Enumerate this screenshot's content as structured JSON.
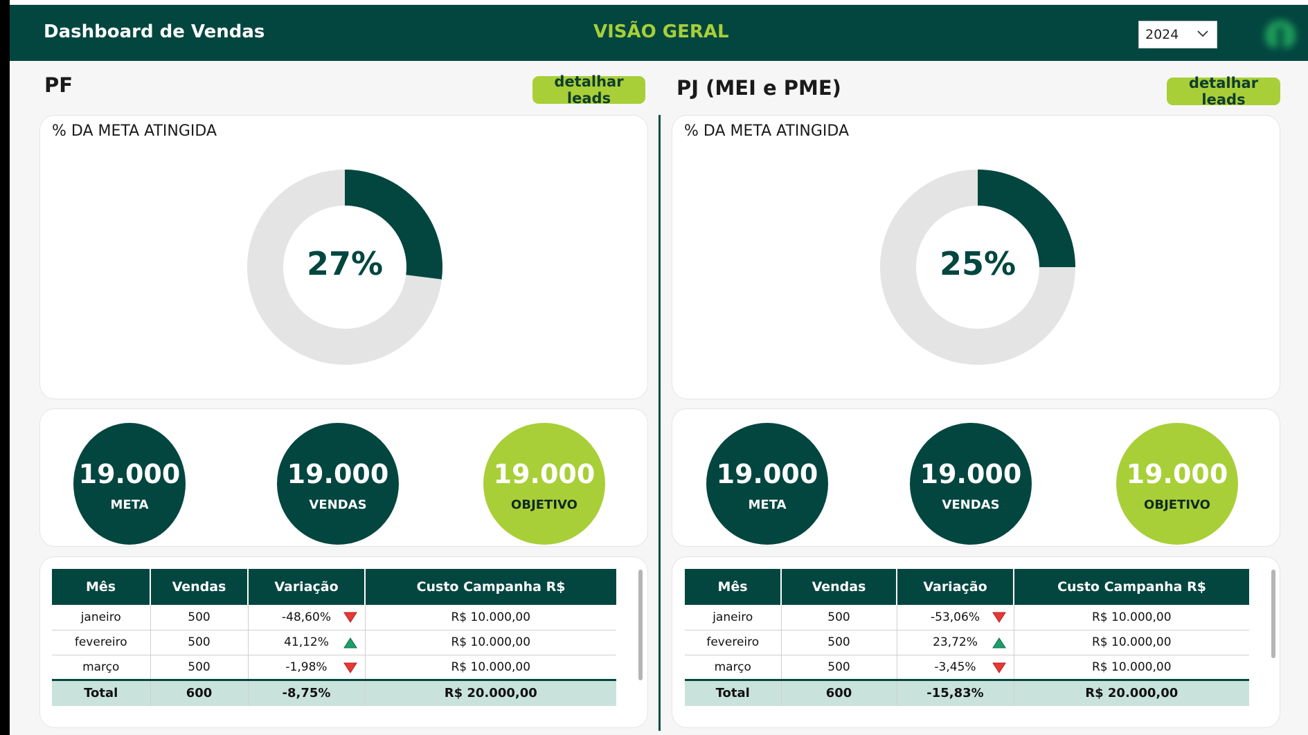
{
  "header": {
    "app_title": "Dashboard de Vendas",
    "page_title": "VISÃO GERAL",
    "year_value": "2024",
    "icons": [
      "chevron-down-icon",
      "logo-icon"
    ]
  },
  "colors": {
    "primary": "#034640",
    "accent": "#a8cf38",
    "down": "#e53935",
    "up": "#1e9e6a",
    "total_row": "#c9e3dc"
  },
  "pf": {
    "title": "PF",
    "leads_button": "detalhar leads",
    "goal_card_title": "% DA META ATINGIDA",
    "goal_percent": 27,
    "goal_label": "27%",
    "kpis": [
      {
        "value": "19.000",
        "label": "META"
      },
      {
        "value": "19.000",
        "label": "VENDAS"
      },
      {
        "value": "19.000",
        "label": "OBJETIVO"
      }
    ],
    "table": {
      "headers": [
        "Mês",
        "Vendas",
        "Variação",
        "Custo Campanha R$"
      ],
      "rows": [
        {
          "mes": "janeiro",
          "vendas": "500",
          "variacao": "-48,60%",
          "trend": "down",
          "custo": "R$ 10.000,00"
        },
        {
          "mes": "fevereiro",
          "vendas": "500",
          "variacao": "41,12%",
          "trend": "up",
          "custo": "R$ 10.000,00"
        },
        {
          "mes": "março",
          "vendas": "500",
          "variacao": "-1,98%",
          "trend": "down",
          "custo": "R$ 10.000,00"
        }
      ],
      "total": {
        "mes": "Total",
        "vendas": "600",
        "variacao": "-8,75%",
        "custo": "R$ 20.000,00"
      }
    }
  },
  "pj": {
    "title": "PJ (MEI e PME)",
    "leads_button": "detalhar leads",
    "goal_card_title": "% DA META ATINGIDA",
    "goal_percent": 25,
    "goal_label": "25%",
    "kpis": [
      {
        "value": "19.000",
        "label": "META"
      },
      {
        "value": "19.000",
        "label": "VENDAS"
      },
      {
        "value": "19.000",
        "label": "OBJETIVO"
      }
    ],
    "table": {
      "headers": [
        "Mês",
        "Vendas",
        "Variação",
        "Custo Campanha R$"
      ],
      "rows": [
        {
          "mes": "janeiro",
          "vendas": "500",
          "variacao": "-53,06%",
          "trend": "down",
          "custo": "R$ 10.000,00"
        },
        {
          "mes": "fevereiro",
          "vendas": "500",
          "variacao": "23,72%",
          "trend": "up",
          "custo": "R$ 10.000,00"
        },
        {
          "mes": "março",
          "vendas": "500",
          "variacao": "-3,45%",
          "trend": "down",
          "custo": "R$ 10.000,00"
        }
      ],
      "total": {
        "mes": "Total",
        "vendas": "600",
        "variacao": "-15,83%",
        "custo": "R$ 20.000,00"
      }
    }
  }
}
